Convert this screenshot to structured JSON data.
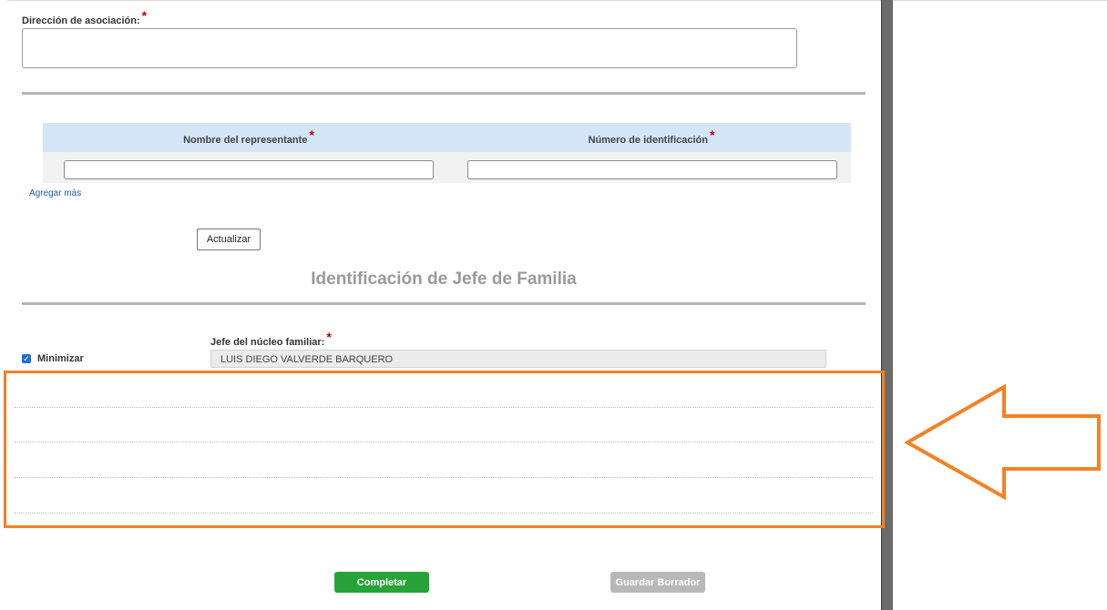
{
  "form": {
    "association_address_label": "Dirección de asociación:",
    "required_mark": "*",
    "association_address_value": ""
  },
  "representatives": {
    "col_name": "Nombre del representante",
    "col_id": "Número de identificación",
    "name_value": "",
    "id_value": "",
    "add_more": "Agregar más"
  },
  "buttons": {
    "update": "Actualizar",
    "complete": "Completar",
    "save_draft": "Guardar Borrador"
  },
  "head_of_family": {
    "section_title": "Identificación de Jefe de Familia",
    "field_label": "Jefe del núcleo familiar:",
    "field_value": "LUIS DIEGO VALVERDE BARQUERO",
    "minimize_label": "Minimizar",
    "minimize_checked": true
  },
  "annotation": {
    "highlight_color": "#f58123"
  }
}
